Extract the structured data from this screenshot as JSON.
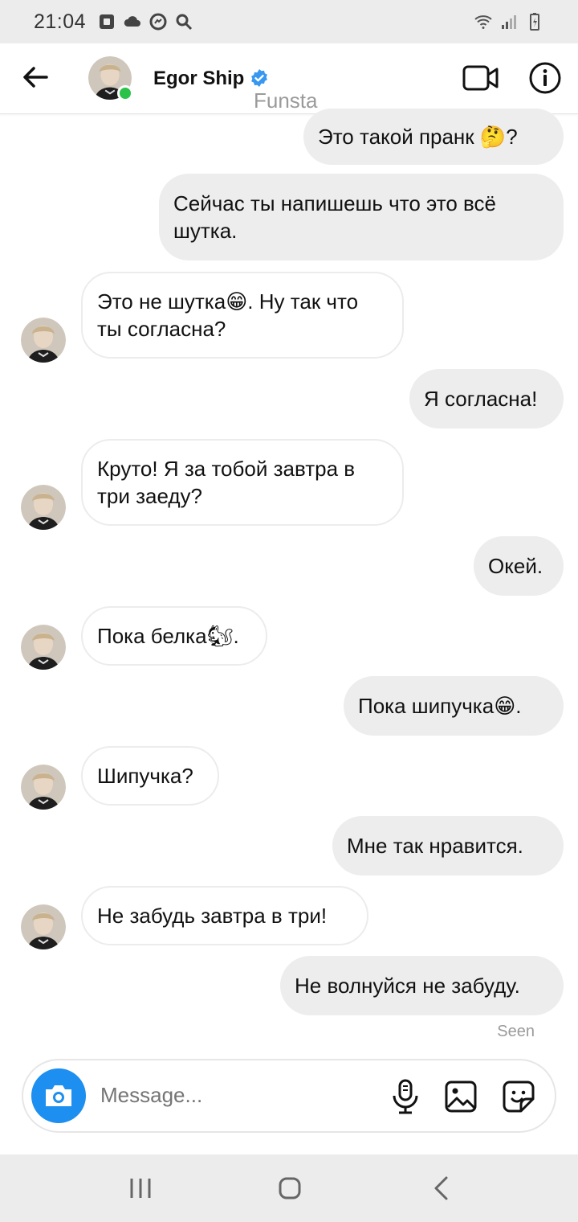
{
  "status_bar": {
    "time": "21:04"
  },
  "header": {
    "name": "Egor Ship",
    "subtitle": "Funsta",
    "online_color": "#2cc24a",
    "verified_color": "#3897f0"
  },
  "messages": [
    {
      "side": "out",
      "text": "Это такой пранк 🤔?"
    },
    {
      "side": "out",
      "text": "Сейчас ты напишешь что это всё шутка."
    },
    {
      "side": "in",
      "text": "Это не шутка😁. Ну так что ты согласна?"
    },
    {
      "side": "out",
      "text": "Я согласна!"
    },
    {
      "side": "in",
      "text": "Круто! Я за тобой завтра в три заеду?"
    },
    {
      "side": "out",
      "text": "Окей."
    },
    {
      "side": "in",
      "text": "Пока белка🐿."
    },
    {
      "side": "out",
      "text": "Пока шипучка😁."
    },
    {
      "side": "in",
      "text": "Шипучка?"
    },
    {
      "side": "out",
      "text": "Мне так нравится."
    },
    {
      "side": "in",
      "text": "Не забудь завтра в три!"
    },
    {
      "side": "out",
      "text": "Не волнуйся не забуду."
    }
  ],
  "seen_label": "Seen",
  "composer": {
    "placeholder": "Message..."
  },
  "colors": {
    "accent": "#1d8ff0",
    "bubble_out": "#ededed"
  }
}
